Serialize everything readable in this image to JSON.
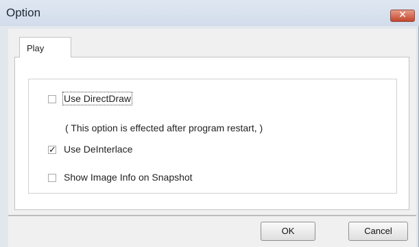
{
  "window": {
    "title": "Option",
    "close_icon": "close-icon (✕)"
  },
  "tabs": [
    {
      "label": "Play",
      "selected": true
    }
  ],
  "options": {
    "use_directdraw": {
      "label": "Use DirectDraw",
      "checked": false
    },
    "directdraw_note": "( This option is effected after program restart, )",
    "use_deinterlace": {
      "label": "Use DeInterlace",
      "checked": true
    },
    "show_image_info": {
      "label": "Show Image Info on Snapshot",
      "checked": false
    }
  },
  "buttons": {
    "ok": "OK",
    "cancel": "Cancel"
  },
  "colors": {
    "frame": "#e2e7ed",
    "close_button": "#c3462d",
    "dialog_face": "#f0f0f0"
  }
}
